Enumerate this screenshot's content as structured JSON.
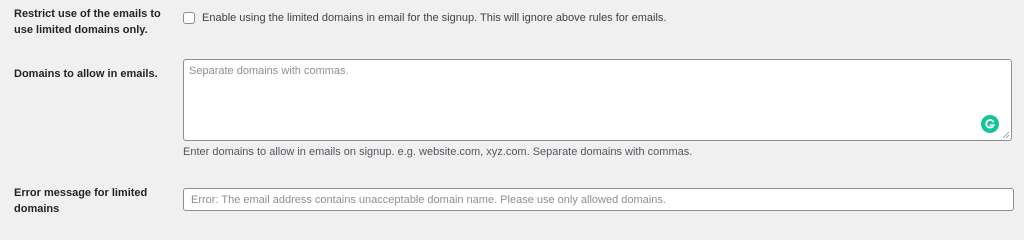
{
  "restrict_row": {
    "label_line1": "Restrict use of the emails to",
    "label_line2": "use limited domains only.",
    "checkbox_label": "Enable using the limited domains in email for the signup. This will ignore above rules for emails.",
    "checked": false
  },
  "domains_row": {
    "label": "Domains to allow in emails.",
    "placeholder": "Separate domains with commas.",
    "value": "",
    "help_text": "Enter domains to allow in emails on signup. e.g. website.com, xyz.com. Separate domains with commas.",
    "grammarly_icon": "grammarly-icon"
  },
  "error_row": {
    "label_line1": "Error message for limited",
    "label_line2": "domains",
    "placeholder": "Error: The email address contains unacceptable domain name. Please use only allowed domains.",
    "value": ""
  },
  "colors": {
    "background": "#f0f0f1",
    "input_border": "#8c8f94",
    "grammarly": "#15c39a"
  }
}
